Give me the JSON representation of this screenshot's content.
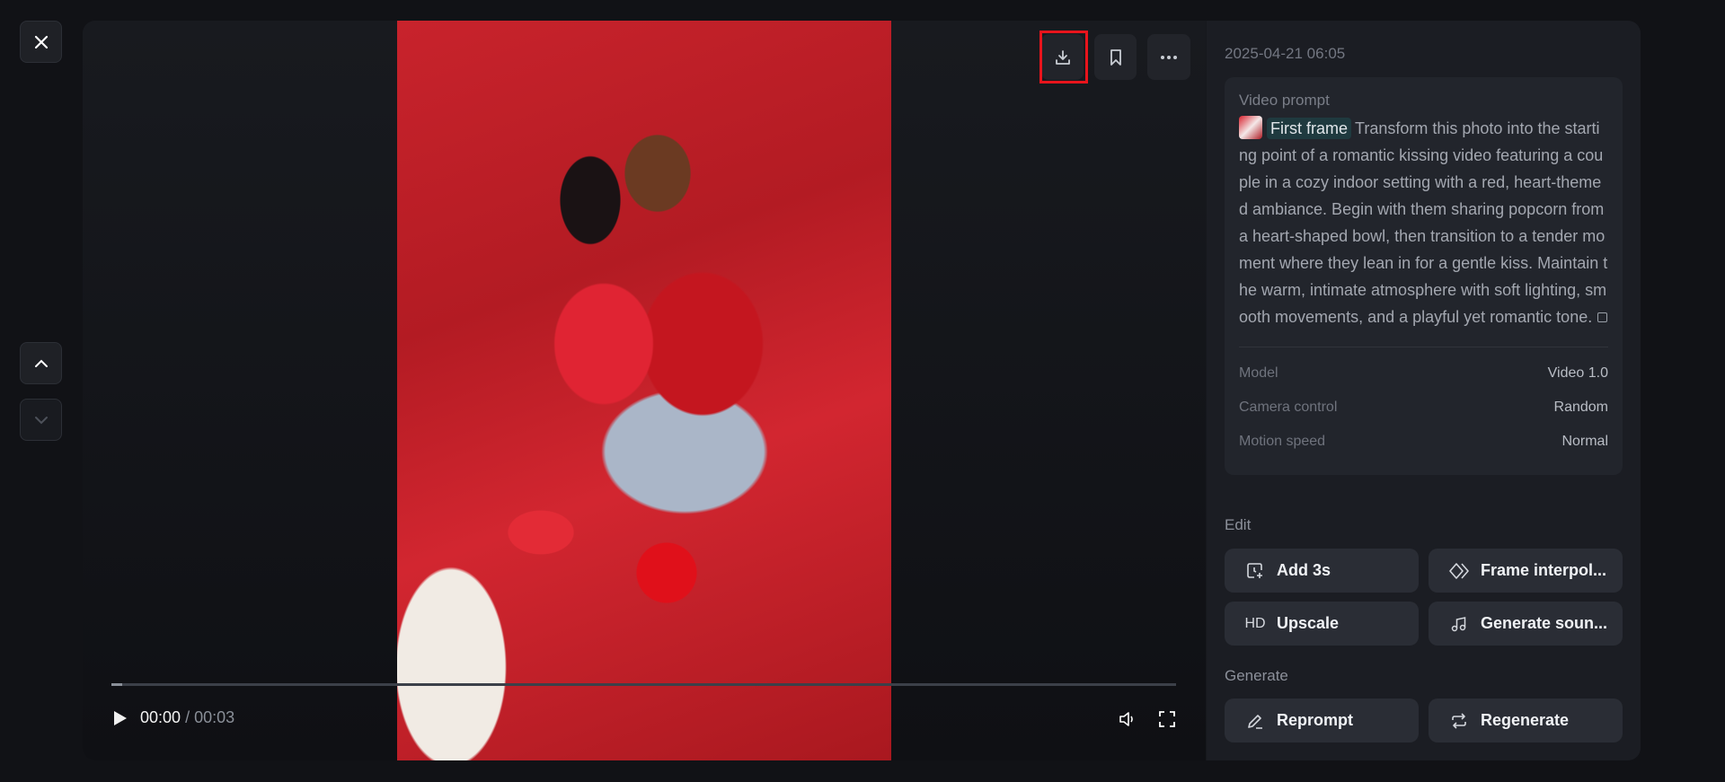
{
  "nav": {
    "close": "close",
    "up": "previous",
    "down": "next"
  },
  "player": {
    "current_time": "00:00",
    "separator": "/",
    "duration": "00:03",
    "progress_fraction": 0.01
  },
  "toolbar": {
    "download": "download",
    "bookmark": "bookmark",
    "more": "more"
  },
  "panel": {
    "timestamp": "2025-04-21 06:05",
    "prompt_label": "Video prompt",
    "first_frame_tag": "First frame",
    "prompt_text": "Transform this photo into the starting point of a romantic kissing video featuring a couple in a cozy indoor setting with a red, heart-themed ambiance. Begin with them sharing popcorn from a heart-shaped bowl, then transition to a tender moment where they lean in for a gentle kiss. Maintain the warm, intimate atmosphere with soft lighting, smooth movements, and a playful yet romantic tone.",
    "details": [
      {
        "key": "Model",
        "value": "Video 1.0"
      },
      {
        "key": "Camera control",
        "value": "Random"
      },
      {
        "key": "Motion speed",
        "value": "Normal"
      }
    ],
    "edit_label": "Edit",
    "edit_buttons": [
      {
        "label": "Add 3s",
        "icon": "clock-plus-icon"
      },
      {
        "label": "Frame interpol...",
        "icon": "diamond-icon"
      },
      {
        "label": "Upscale",
        "icon": "HD"
      },
      {
        "label": "Generate soun...",
        "icon": "music-note-icon"
      }
    ],
    "generate_label": "Generate",
    "generate_buttons": [
      {
        "label": "Reprompt",
        "icon": "pencil-icon"
      },
      {
        "label": "Regenerate",
        "icon": "repeat-icon"
      }
    ]
  },
  "colors": {
    "highlight": "#e8141c",
    "panel": "#1b1d23",
    "button": "#2a2d35"
  }
}
